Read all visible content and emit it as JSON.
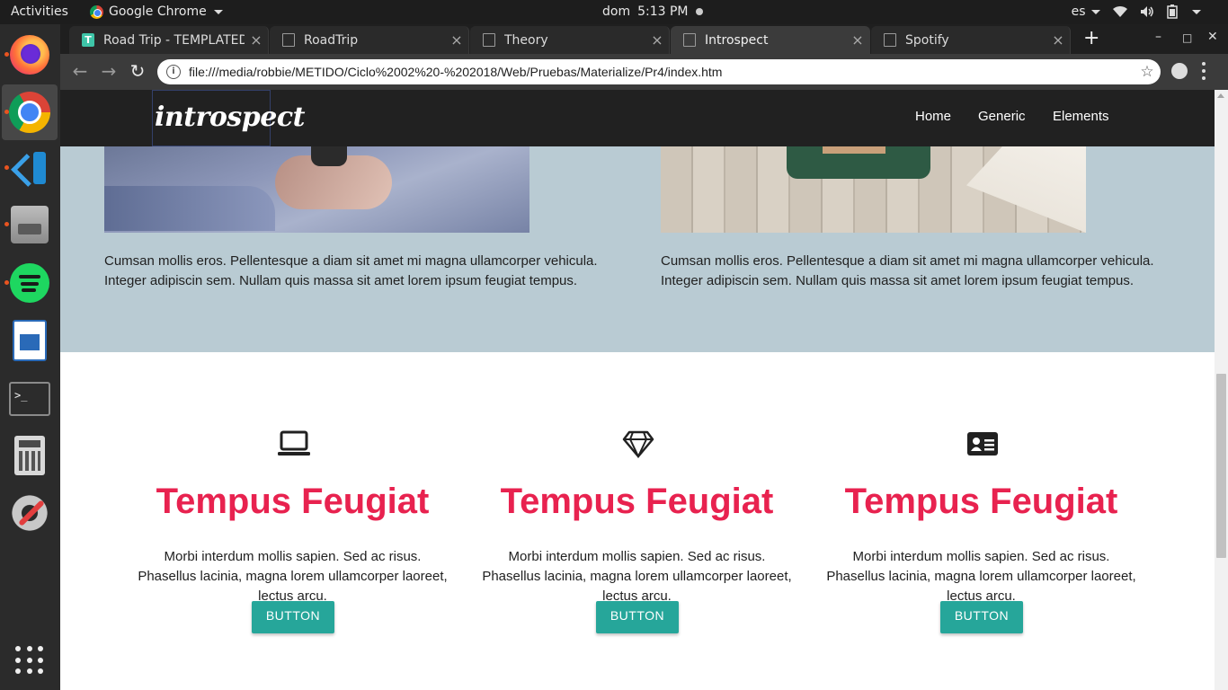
{
  "topbar": {
    "activities": "Activities",
    "app_name": "Google Chrome",
    "day": "dom",
    "time": "5:13 PM",
    "keyboard_layout": "es"
  },
  "dock": {
    "items": [
      {
        "name": "firefox-icon"
      },
      {
        "name": "chrome-icon"
      },
      {
        "name": "vscode-icon"
      },
      {
        "name": "files-icon"
      },
      {
        "name": "spotify-icon"
      },
      {
        "name": "writer-icon"
      },
      {
        "name": "terminal-icon"
      },
      {
        "name": "calculator-icon"
      },
      {
        "name": "settings-icon"
      },
      {
        "name": "show-apps-icon"
      }
    ],
    "terminal_glyph": ">_"
  },
  "browser": {
    "tabs": [
      {
        "title": "Road Trip - TEMPLATED",
        "favicon_letter": "T",
        "active": false
      },
      {
        "title": "RoadTrip",
        "active": false
      },
      {
        "title": "Theory",
        "active": false
      },
      {
        "title": "Introspect",
        "active": true
      },
      {
        "title": "Spotify",
        "active": false
      }
    ],
    "tab_close_glyph": "×",
    "new_tab_glyph": "+",
    "url": "file:///media/robbie/METIDO/Ciclo%2002%20-%202018/Web/Pruebas/Materialize/Pr4/index.htm",
    "info_glyph": "i",
    "star_glyph": "☆",
    "back_glyph": "←",
    "forward_glyph": "→",
    "reload_glyph": "↻",
    "minimize_glyph": "–",
    "maximize_glyph": "□",
    "close_glyph": "✕"
  },
  "site": {
    "logo": "introspect",
    "nav": [
      "Home",
      "Generic",
      "Elements"
    ],
    "band": {
      "background": "#b9cbd3",
      "left_text": "Cumsan mollis eros. Pellentesque a diam sit amet mi magna ullamcorper vehicula. Integer adipiscin sem. Nullam quis massa sit amet lorem ipsum feugiat tempus.",
      "right_text": "Cumsan mollis eros. Pellentesque a diam sit amet mi magna ullamcorper vehicula. Integer adipiscin sem. Nullam quis massa sit amet lorem ipsum feugiat tempus."
    },
    "features": [
      {
        "icon": "laptop-icon",
        "title": "Tempus Feugiat",
        "text": "Morbi interdum mollis sapien. Sed ac risus. Phasellus lacinia, magna lorem ullamcorper laoreet, lectus arcu.",
        "button": "BUTTON"
      },
      {
        "icon": "diamond-icon",
        "title": "Tempus Feugiat",
        "text": "Morbi interdum mollis sapien. Sed ac risus. Phasellus lacinia, magna lorem ullamcorper laoreet, lectus arcu.",
        "button": "BUTTON"
      },
      {
        "icon": "id-card-icon",
        "title": "Tempus Feugiat",
        "text": "Morbi interdum mollis sapien. Sed ac risus. Phasellus lacinia, magna lorem ullamcorper laoreet, lectus arcu.",
        "button": "BUTTON"
      }
    ],
    "colors": {
      "accent": "#e8224f",
      "button": "#26a69a",
      "navbar": "#212121"
    }
  }
}
